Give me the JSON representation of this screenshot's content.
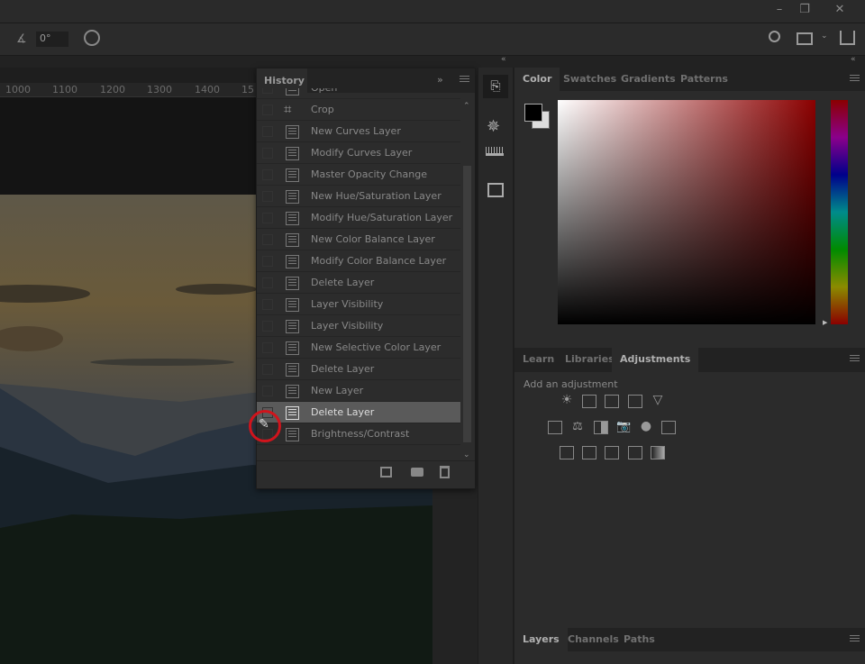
{
  "toolbar": {
    "angle_value": "0°"
  },
  "ruler": {
    "ticks": [
      "1000",
      "1100",
      "1200",
      "1300",
      "1400",
      "15"
    ]
  },
  "history": {
    "title": "History",
    "items": [
      "Open",
      "Crop",
      "New Curves Layer",
      "Modify Curves Layer",
      "Master Opacity Change",
      "New Hue/Saturation Layer",
      "Modify Hue/Saturation Layer",
      "New Color Balance Layer",
      "Modify Color Balance Layer",
      "Delete Layer",
      "Layer Visibility",
      "Layer Visibility",
      "New Selective Color Layer",
      "Delete Layer",
      "New Layer",
      "Delete Layer",
      "Brightness/Contrast"
    ],
    "selected_index": 15
  },
  "color_panel": {
    "tabs": [
      "Color",
      "Swatches",
      "Gradients",
      "Patterns"
    ],
    "active": "Color",
    "foreground": "#000000",
    "background": "#ffffff",
    "hue": "#8b0000"
  },
  "adjustments_panel": {
    "tabs": [
      "Learn",
      "Libraries",
      "Adjustments"
    ],
    "active": "Adjustments",
    "heading": "Add an adjustment"
  },
  "layers_panel": {
    "tabs": [
      "Layers",
      "Channels",
      "Paths"
    ],
    "active": "Layers"
  },
  "colors": {
    "highlight_ring": "#d0141c"
  }
}
